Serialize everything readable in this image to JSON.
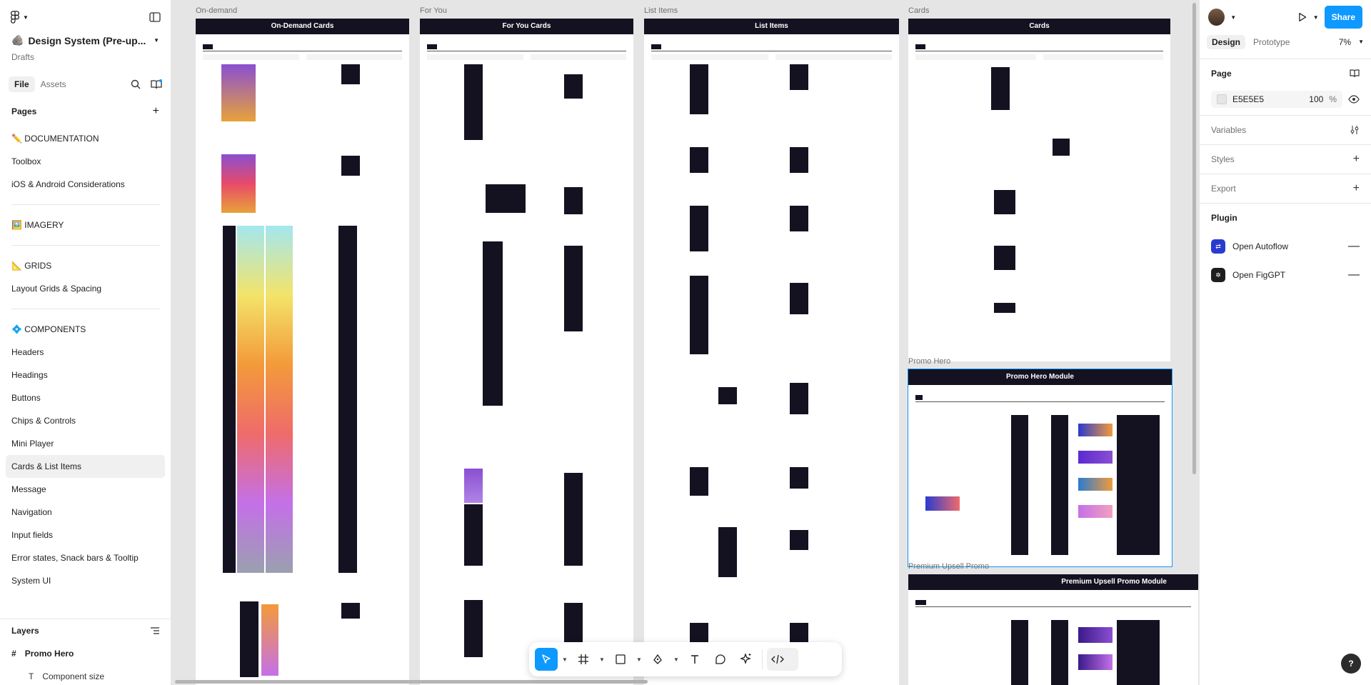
{
  "left_panel": {
    "file_name": "Design System (Pre-up...",
    "drafts": "Drafts",
    "tabs": {
      "file": "File",
      "assets": "Assets"
    },
    "pages_title": "Pages",
    "pages": [
      {
        "label": "✏️ DOCUMENTATION"
      },
      {
        "label": "Toolbox"
      },
      {
        "label": "iOS & Android Considerations"
      },
      {
        "label": "🖼️ IMAGERY"
      },
      {
        "label": "📐 GRIDS"
      },
      {
        "label": "Layout Grids & Spacing"
      },
      {
        "label": "💠 COMPONENTS"
      },
      {
        "label": "Headers"
      },
      {
        "label": "Headings"
      },
      {
        "label": "Buttons"
      },
      {
        "label": "Chips & Controls"
      },
      {
        "label": "Mini Player"
      },
      {
        "label": "Cards & List Items"
      },
      {
        "label": "Message"
      },
      {
        "label": "Navigation"
      },
      {
        "label": "Input fields"
      },
      {
        "label": "Error states, Snack bars & Tooltip"
      },
      {
        "label": "System UI"
      }
    ],
    "layers_title": "Layers",
    "layers": [
      {
        "label": "Promo Hero"
      },
      {
        "label": "Component size"
      }
    ]
  },
  "canvas": {
    "frames": [
      {
        "label": "On-demand",
        "title": "On-Demand Cards"
      },
      {
        "label": "For You",
        "title": "For You Cards"
      },
      {
        "label": "List Items",
        "title": "List Items"
      },
      {
        "label": "Cards",
        "title": "Cards"
      },
      {
        "label": "Promo Hero",
        "title": "Promo Hero Module"
      },
      {
        "label": "Premium Upsell Promo",
        "title": "Premium Upsell Promo Module"
      }
    ]
  },
  "right_panel": {
    "tabs": {
      "design": "Design",
      "prototype": "Prototype"
    },
    "zoom": "7%",
    "share": "Share",
    "page_title": "Page",
    "fill_hex": "E5E5E5",
    "fill_opacity": "100",
    "fill_unit": "%",
    "variables": "Variables",
    "styles": "Styles",
    "export": "Export",
    "plugin_title": "Plugin",
    "plugins": [
      {
        "label": "Open Autoflow"
      },
      {
        "label": "Open FigGPT"
      }
    ],
    "help": "?"
  },
  "colors": {
    "accent": "#0d99ff",
    "canvas_bg": "#e5e5e5",
    "frame_header": "#141221"
  }
}
